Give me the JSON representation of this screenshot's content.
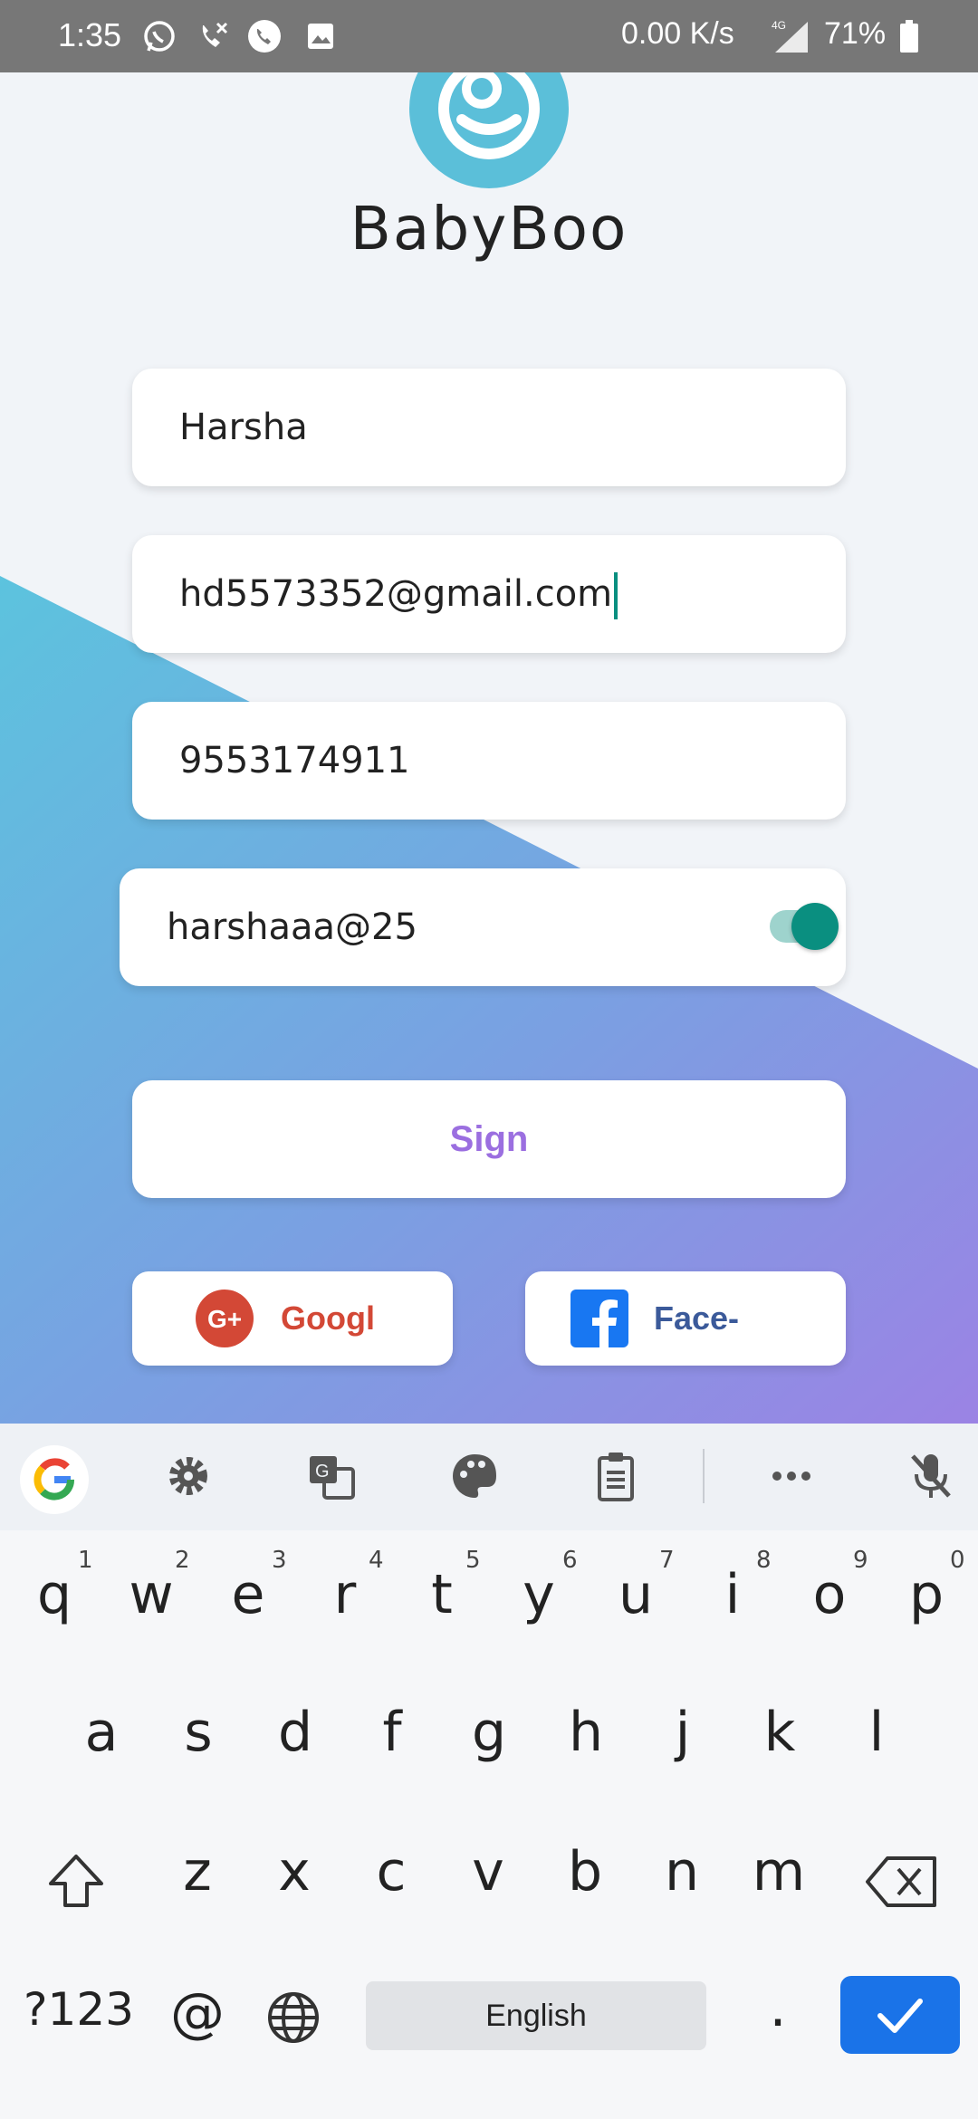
{
  "status_bar": {
    "time": "1:35",
    "net_speed": "0.00 K/s",
    "network_type": "4G",
    "battery": "71%"
  },
  "app": {
    "brand_name": "BabyBoo",
    "fields": {
      "name_value": "Harsha",
      "email_value": "hd5573352@gmail.com",
      "phone_value": "9553174911",
      "password_value": "harshaaa@25",
      "password_visible": true
    },
    "sign_button_label": "Sign",
    "google_button_label": "Googl",
    "facebook_button_label": "Face-",
    "colors": {
      "accent_teal": "#0a8f80",
      "sign_text": "#9b6fe0",
      "gradient_start": "#5cc3de",
      "gradient_end": "#9b83e4"
    }
  },
  "keyboard": {
    "toolbar_icons": [
      "google-icon",
      "settings-icon",
      "translate-icon",
      "palette-icon",
      "clipboard-icon",
      "more-icon",
      "mic-off-icon"
    ],
    "row1": [
      "q",
      "w",
      "e",
      "r",
      "t",
      "y",
      "u",
      "i",
      "o",
      "p"
    ],
    "row1_hints": [
      "1",
      "2",
      "3",
      "4",
      "5",
      "6",
      "7",
      "8",
      "9",
      "0"
    ],
    "row2": [
      "a",
      "s",
      "d",
      "f",
      "g",
      "h",
      "j",
      "k",
      "l"
    ],
    "row3": [
      "z",
      "x",
      "c",
      "v",
      "b",
      "n",
      "m"
    ],
    "symbols_key": "?123",
    "at_key": "@",
    "space_label": "English",
    "period_key": "."
  }
}
